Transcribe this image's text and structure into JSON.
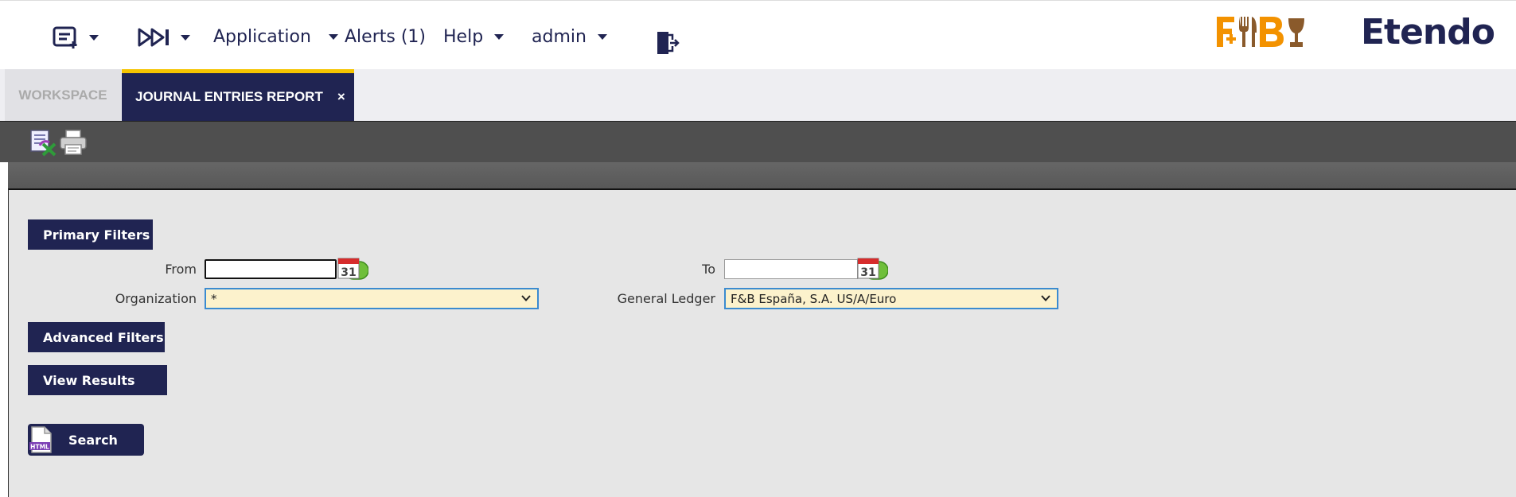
{
  "nav": {
    "application": "Application",
    "alerts": "Alerts (1)",
    "help": "Help",
    "user": "admin"
  },
  "brand": {
    "fnb": "F+B",
    "etendo": "Etendo",
    "fnb_orange": "#f39200",
    "fnb_brown": "#8a5a2b",
    "navy": "#202452"
  },
  "tabs": {
    "workspace": "WORKSPACE",
    "active": "JOURNAL ENTRIES REPORT",
    "close": "×"
  },
  "sections": {
    "primary": "Primary Filters",
    "advanced": "Advanced Filters",
    "view_results": "View Results"
  },
  "filters": {
    "from_label": "From",
    "from_value": "",
    "to_label": "To",
    "to_value": "",
    "calendar_day": "31",
    "organization_label": "Organization",
    "organization_value": "*",
    "ledger_label": "General Ledger",
    "ledger_value": "F&B España, S.A. US/A/Euro"
  },
  "actions": {
    "search": "Search",
    "html_badge": "HTML"
  }
}
